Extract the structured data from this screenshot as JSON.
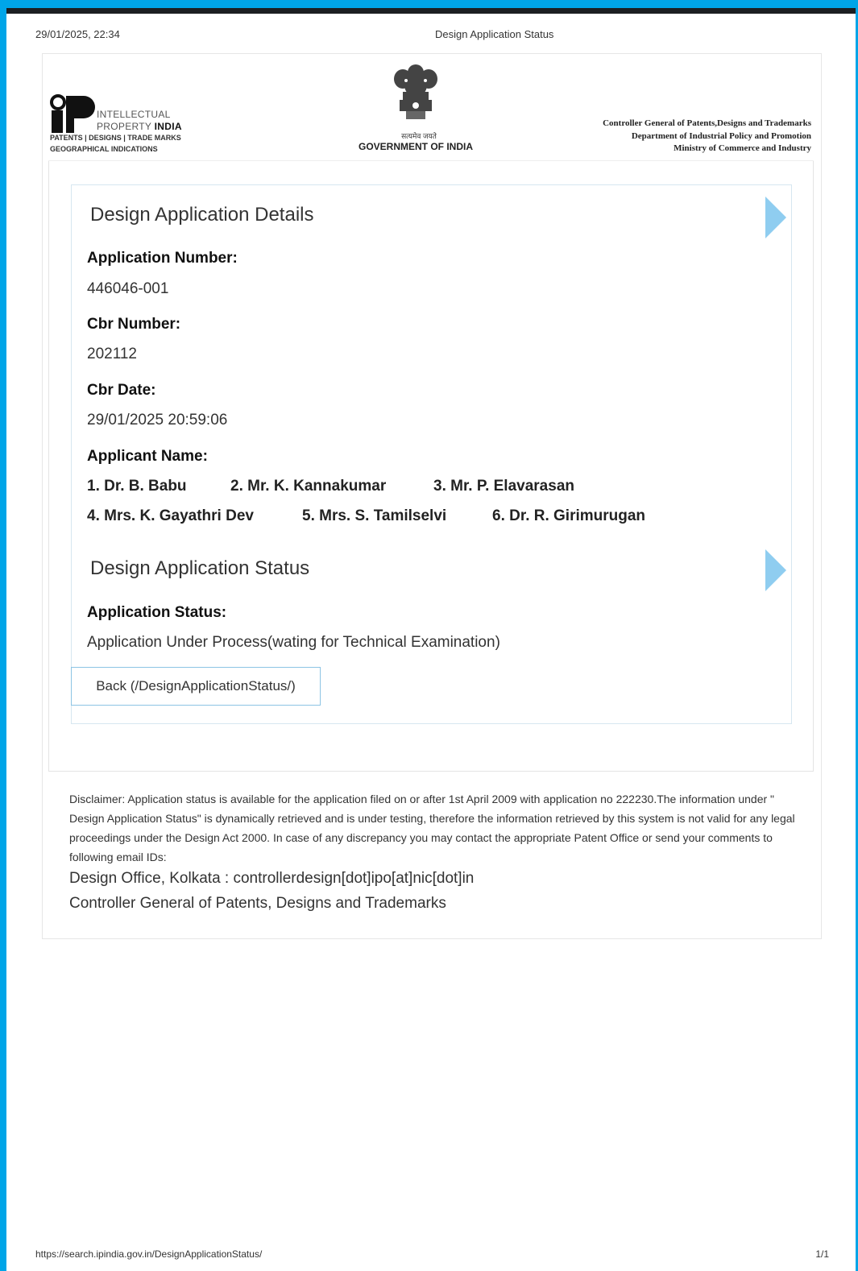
{
  "print_header": {
    "date_time": "29/01/2025, 22:34",
    "title": "Design Application Status"
  },
  "print_footer": {
    "url": "https://search.ipindia.gov.in/DesignApplicationStatus/",
    "page": "1/1"
  },
  "logos": {
    "ip_line1": "INTELLECTUAL",
    "ip_line2a": "PROPERTY ",
    "ip_line2b": "INDIA",
    "ip_line3": "PATENTS | DESIGNS | TRADE MARKS",
    "ip_line4": "GEOGRAPHICAL INDICATIONS",
    "emblem_hindi": "सत्यमेव जयते",
    "gov_text": "GOVERNMENT OF INDIA",
    "cg_line1": "Controller General of Patents,Designs and Trademarks",
    "cg_line2": "Department of Industrial Policy and Promotion",
    "cg_line3": "Ministry of Commerce and Industry"
  },
  "details": {
    "section_title": "Design Application Details",
    "application_number_label": "Application Number:",
    "application_number": "446046-001",
    "cbr_number_label": "Cbr Number:",
    "cbr_number": "202112",
    "cbr_date_label": "Cbr Date:",
    "cbr_date": "29/01/2025 20:59:06",
    "applicant_name_label": "Applicant Name:",
    "applicants": [
      "1. Dr. B. Babu",
      "2. Mr. K. Kannakumar",
      "3. Mr. P. Elavarasan",
      "4. Mrs. K. Gayathri Dev",
      "5. Mrs. S. Tamilselvi",
      "6. Dr. R. Girimurugan"
    ]
  },
  "status": {
    "section_title": "Design Application Status",
    "application_status_label": "Application Status:",
    "application_status": "Application Under Process(wating for Technical Examination)"
  },
  "back_button_label": "Back (/DesignApplicationStatus/)",
  "disclaimer": {
    "text": "Disclaimer: Application status is available for the application filed on or after 1st April 2009 with application no 222230.The information under \" Design Application Status\" is dynamically retrieved and is under testing, therefore the information retrieved by this system is not valid for any legal proceedings under the Design Act 2000. In case of any discrepancy you may contact the appropriate Patent Office or send your comments to following email IDs:",
    "contact_line1": "Design Office, Kolkata : controllerdesign[dot]ipo[at]nic[dot]in",
    "contact_line2": "Controller General of Patents, Designs and Trademarks"
  },
  "colors": {
    "frame_accent": "#00a5e8",
    "arrow": "#8fcdf0",
    "button_border": "#8cc4e4"
  },
  "icons": {
    "section_arrow": "chevron-right-icon",
    "ip_logo": "ip-india-logo",
    "emblem": "state-emblem-icon"
  }
}
